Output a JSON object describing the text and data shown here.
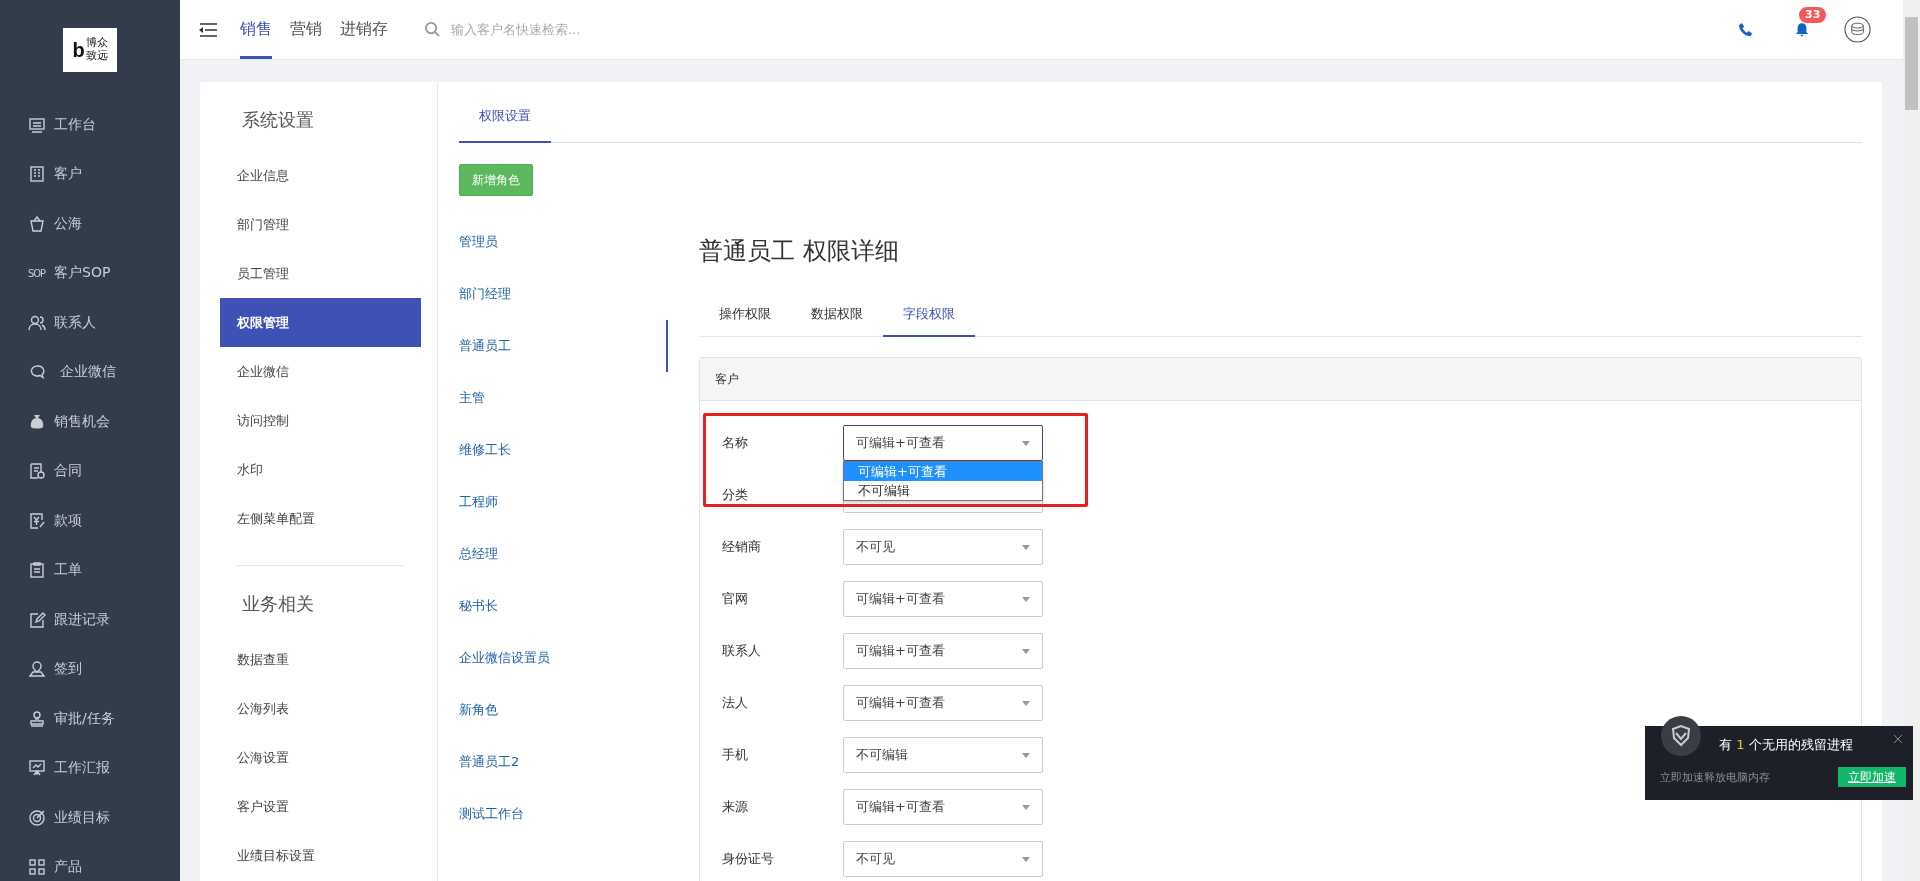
{
  "logo": {
    "mark": "b",
    "lines": [
      "博众",
      "致远"
    ]
  },
  "sidebar": {
    "items": [
      {
        "label": "工作台"
      },
      {
        "label": "客户"
      },
      {
        "label": "公海"
      },
      {
        "label": "客户SOP",
        "icon_text": "SOP"
      },
      {
        "label": "联系人"
      },
      {
        "label": "企业微信"
      },
      {
        "label": "销售机会"
      },
      {
        "label": "合同"
      },
      {
        "label": "款项"
      },
      {
        "label": "工单"
      },
      {
        "label": "跟进记录"
      },
      {
        "label": "签到"
      },
      {
        "label": "审批/任务"
      },
      {
        "label": "工作汇报"
      },
      {
        "label": "业绩目标"
      },
      {
        "label": "产品"
      }
    ]
  },
  "header": {
    "tabs": [
      {
        "label": "销售",
        "selected": true
      },
      {
        "label": "营销",
        "selected": false
      },
      {
        "label": "进销存",
        "selected": false
      }
    ],
    "search": {
      "placeholder": "输入客户名快速检索..."
    },
    "notifications": {
      "count": "33"
    }
  },
  "settings_menu": {
    "sections": [
      {
        "title": "系统设置",
        "items": [
          {
            "label": "企业信息",
            "selected": false
          },
          {
            "label": "部门管理",
            "selected": false
          },
          {
            "label": "员工管理",
            "selected": false
          },
          {
            "label": "权限管理",
            "selected": true
          },
          {
            "label": "企业微信",
            "selected": false
          },
          {
            "label": "访问控制",
            "selected": false
          },
          {
            "label": "水印",
            "selected": false
          },
          {
            "label": "左侧菜单配置",
            "selected": false
          }
        ]
      },
      {
        "title": "业务相关",
        "items": [
          {
            "label": "数据查重",
            "selected": false
          },
          {
            "label": "公海列表",
            "selected": false
          },
          {
            "label": "公海设置",
            "selected": false
          },
          {
            "label": "客户设置",
            "selected": false
          },
          {
            "label": "业绩目标设置",
            "selected": false
          }
        ]
      }
    ]
  },
  "page_tabs": [
    {
      "label": "权限设置",
      "selected": true
    }
  ],
  "add_role_button": "新增角色",
  "roles": [
    {
      "label": "管理员",
      "selected": false
    },
    {
      "label": "部门经理",
      "selected": false
    },
    {
      "label": "普通员工",
      "selected": true
    },
    {
      "label": "主管",
      "selected": false
    },
    {
      "label": "维修工长",
      "selected": false
    },
    {
      "label": "工程师",
      "selected": false
    },
    {
      "label": "总经理",
      "selected": false
    },
    {
      "label": "秘书长",
      "selected": false
    },
    {
      "label": "企业微信设置员",
      "selected": false
    },
    {
      "label": "新角色",
      "selected": false
    },
    {
      "label": "普通员工2",
      "selected": false
    },
    {
      "label": "测试工作台",
      "selected": false
    }
  ],
  "detail": {
    "title": "普通员工 权限详细",
    "tabs": [
      {
        "label": "操作权限",
        "selected": false
      },
      {
        "label": "数据权限",
        "selected": false
      },
      {
        "label": "字段权限",
        "selected": true
      }
    ],
    "panel_title": "客户",
    "fields": [
      {
        "label": "名称",
        "value": "可编辑+可查看",
        "expanded": true,
        "highlighted": true,
        "options": [
          {
            "label": "可编辑+可查看",
            "selected": true
          },
          {
            "label": "不可编辑",
            "selected": false
          }
        ]
      },
      {
        "label": "分类",
        "expanded": false,
        "highlighted": false
      },
      {
        "label": "经销商",
        "value": "不可见",
        "expanded": false,
        "highlighted": false
      },
      {
        "label": "官网",
        "value": "可编辑+可查看",
        "expanded": false,
        "highlighted": false
      },
      {
        "label": "联系人",
        "value": "可编辑+可查看",
        "expanded": false,
        "highlighted": false
      },
      {
        "label": "法人",
        "value": "可编辑+可查看",
        "expanded": false,
        "highlighted": false
      },
      {
        "label": "手机",
        "value": "不可编辑",
        "expanded": false,
        "highlighted": false
      },
      {
        "label": "来源",
        "value": "可编辑+可查看",
        "expanded": false,
        "highlighted": false
      },
      {
        "label": "身份证号",
        "value": "不可见",
        "expanded": false,
        "highlighted": false
      }
    ]
  },
  "toast": {
    "prefix": "有",
    "count": "1",
    "suffix": "个无用的残留进程",
    "message": "立即加速释放电脑内存",
    "button": "立即加速"
  }
}
